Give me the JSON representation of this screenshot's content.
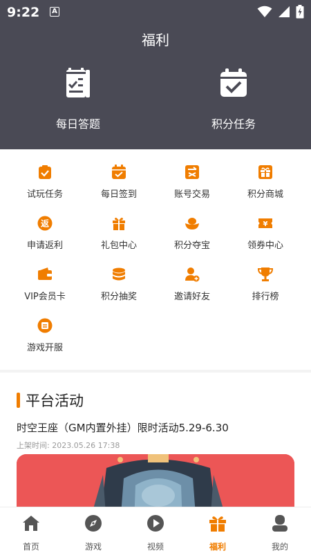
{
  "status": {
    "time": "9:22",
    "notification_letter": "A"
  },
  "header": {
    "title": "福利",
    "big_actions": [
      {
        "label": "每日答题",
        "icon": "quiz-sheet-icon"
      },
      {
        "label": "积分任务",
        "icon": "calendar-check-icon"
      }
    ]
  },
  "grid": {
    "items": [
      {
        "label": "试玩任务",
        "icon": "clipboard-check-icon"
      },
      {
        "label": "每日签到",
        "icon": "calendar-check-icon"
      },
      {
        "label": "账号交易",
        "icon": "exchange-icon"
      },
      {
        "label": "积分商城",
        "icon": "gift-box-icon"
      },
      {
        "label": "申请返利",
        "icon": "rebate-icon"
      },
      {
        "label": "礼包中心",
        "icon": "gift-icon"
      },
      {
        "label": "积分夺宝",
        "icon": "treasure-icon"
      },
      {
        "label": "领券中心",
        "icon": "coupon-icon"
      },
      {
        "label": "VIP会员卡",
        "icon": "wallet-icon"
      },
      {
        "label": "积分抽奖",
        "icon": "coins-icon"
      },
      {
        "label": "邀请好友",
        "icon": "add-user-icon"
      },
      {
        "label": "排行榜",
        "icon": "trophy-icon"
      },
      {
        "label": "游戏开服",
        "icon": "server-icon"
      }
    ]
  },
  "activity": {
    "section_title": "平台活动",
    "title": "时空王座（GM内置外挂）限时活动5.29-6.30",
    "time": "上架时间: 2023.05.26 17:38"
  },
  "tabs": [
    {
      "label": "首页",
      "icon": "home-icon"
    },
    {
      "label": "游戏",
      "icon": "compass-icon"
    },
    {
      "label": "视频",
      "icon": "play-icon"
    },
    {
      "label": "福利",
      "icon": "gift-icon",
      "active": true
    },
    {
      "label": "我的",
      "icon": "user-icon"
    }
  ],
  "colors": {
    "accent": "#f07d00",
    "header_bg": "#4a4a55",
    "banner_bg": "#ec5656"
  }
}
